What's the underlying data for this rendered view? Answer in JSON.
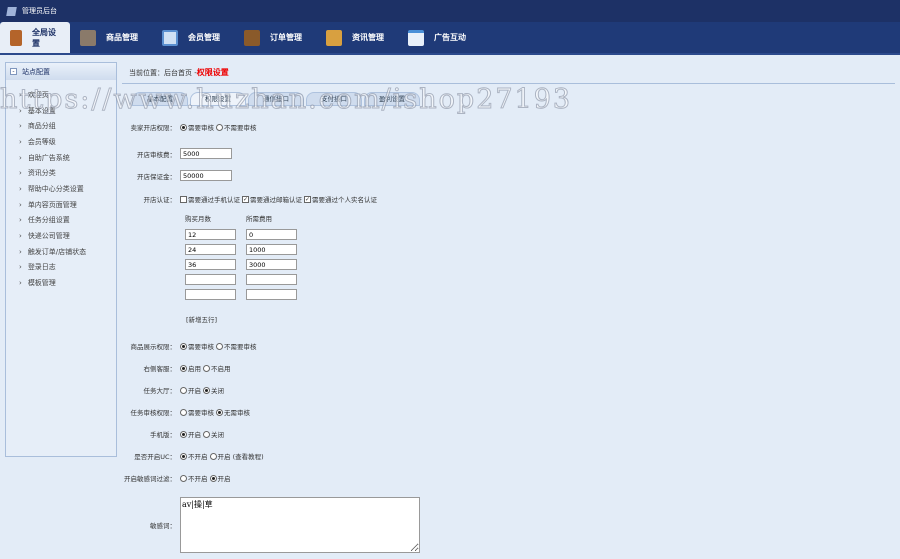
{
  "app_title": "管理员后台",
  "nav": [
    {
      "label": "全局设置",
      "color": "#b4642a"
    },
    {
      "label": "商品管理",
      "color": "#8a7a6a"
    },
    {
      "label": "会员管理",
      "color": "#5a8fd0"
    },
    {
      "label": "订单管理",
      "color": "#8a5a2a"
    },
    {
      "label": "资讯管理",
      "color": "#d8a040"
    },
    {
      "label": "广告互动",
      "color": "#4a90d8"
    }
  ],
  "sidebar": {
    "title": "站点配置",
    "items": [
      "欢迎页",
      "基本设置",
      "商品分组",
      "会员等级",
      "自助广告系统",
      "资讯分类",
      "帮助中心分类设置",
      "单内容页面管理",
      "任务分组设置",
      "快递公司管理",
      "触发订单/店铺状态",
      "登录日志",
      "模板管理"
    ]
  },
  "breadcrumb": {
    "prefix": "当前位置：后台首页 - ",
    "current": "权限设置"
  },
  "tabs": [
    "基本配置",
    "权限设置",
    "通信接口",
    "支付接口",
    "盈利设置"
  ],
  "form": {
    "shop_perm": {
      "label": "卖家开店权限：",
      "options": [
        "需要审核",
        "不需要审核"
      ],
      "selected": 0
    },
    "audit_fee": {
      "label": "开店审核费：",
      "value": "5000"
    },
    "deposit": {
      "label": "开店保证金：",
      "value": "50000"
    },
    "verify": {
      "label": "开店认证：",
      "options": [
        {
          "label": "需要通过手机认证",
          "checked": false
        },
        {
          "label": "需要通过邮箱认证",
          "checked": true
        },
        {
          "label": "需要通过个人实名认证",
          "checked": true
        }
      ]
    },
    "plan_headers": [
      "购买月数",
      "所需费用"
    ],
    "plans": [
      [
        "12",
        "0"
      ],
      [
        "24",
        "1000"
      ],
      [
        "36",
        "3000"
      ],
      [
        "",
        ""
      ],
      [
        "",
        ""
      ]
    ],
    "add_rows": "[新增五行]",
    "goods_perm": {
      "label": "商品展示权限：",
      "options": [
        "需要审核",
        "不需要审核"
      ],
      "selected": 0
    },
    "service": {
      "label": "右侧客服：",
      "options": [
        "启用",
        "不启用"
      ],
      "selected": 0
    },
    "task_hall": {
      "label": "任务大厅：",
      "options": [
        "开启",
        "关闭"
      ],
      "selected": 1
    },
    "task_perm": {
      "label": "任务审核权限：",
      "options": [
        "需要审核",
        "无需审核"
      ],
      "selected": 1
    },
    "mobile": {
      "label": "手机版：",
      "options": [
        "开启",
        "关闭"
      ],
      "selected": 0
    },
    "uc": {
      "label": "是否开启UC：",
      "options": [
        "不开启",
        "开启 (查看教程)"
      ],
      "selected": 0
    },
    "filter": {
      "label": "开启敏感词过滤：",
      "options": [
        "不开启",
        "开启"
      ],
      "selected": 1
    },
    "words": {
      "label": "敏感词：",
      "value": "av|操|草"
    }
  },
  "watermark": "https://www.huzhan.com/ishop27193"
}
